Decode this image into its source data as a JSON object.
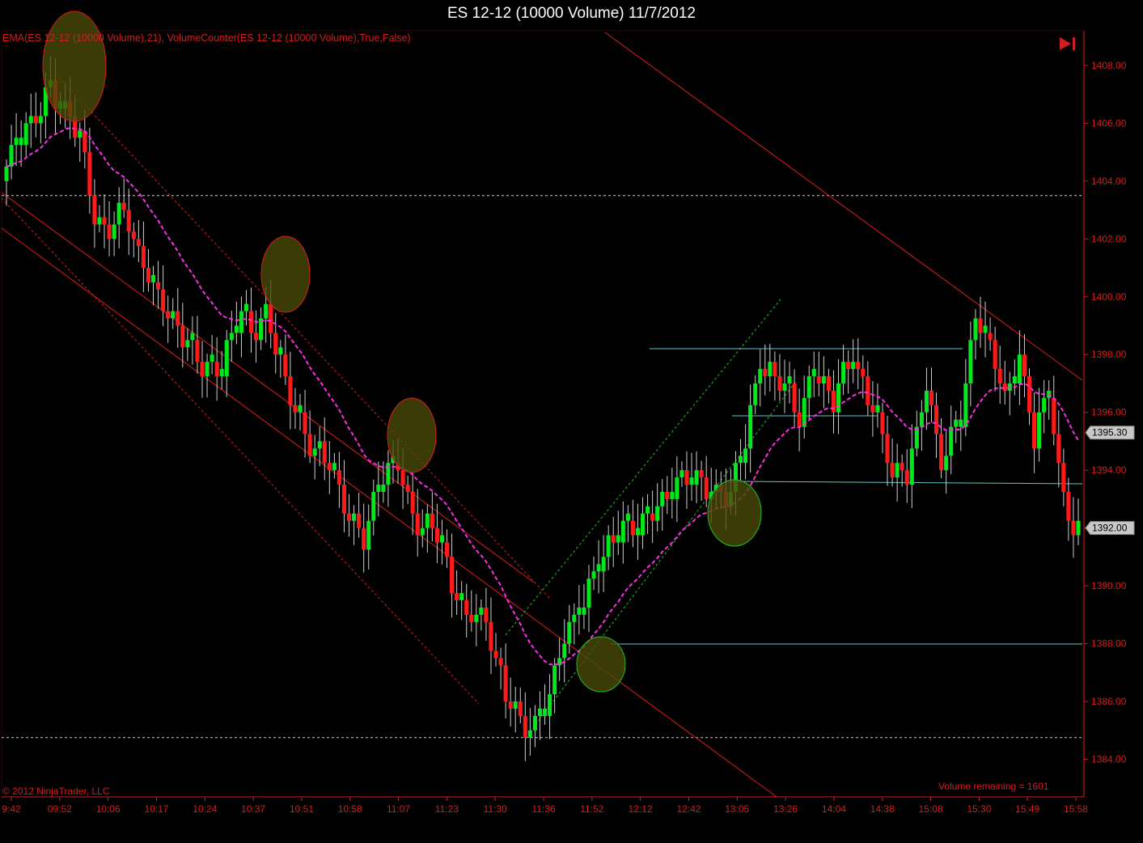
{
  "window": {
    "title": "ES 12-12 (10000 Volume)  11/7/2012"
  },
  "indicator_label": "EMA(ES  12-12  (10000  Volume),21),  VolumeCounter(ES  12-12  (10000  Volume),True,False)",
  "copyright": "© 2012 NinjaTrader, LLC",
  "volume_remaining": "Volume remaining = 1601",
  "icons": {
    "skip_to_end": "skip-to-end-icon"
  },
  "colors": {
    "up": "#00e81c",
    "down": "#ff1a1a",
    "ema": "#ff2ee6",
    "axis": "#d21e1e",
    "trend": "#e01c1c",
    "channel": "#1ec21e",
    "level": "#5fc8c8",
    "ellipse_fill": "#4a4a0a"
  },
  "chart_data": {
    "type": "candlestick",
    "title": "ES 12-12 (10000 Volume)  11/7/2012",
    "ylim": [
      1382.7,
      1409.2
    ],
    "y_ticks": [
      "1408.00",
      "1406.00",
      "1404.00",
      "1402.00",
      "1400.00",
      "1398.00",
      "1396.00",
      "1394.00",
      "1392.00",
      "1390.00",
      "1388.00",
      "1386.00",
      "1384.00"
    ],
    "x_ticks": [
      "9:42",
      "09:52",
      "10:06",
      "10:17",
      "10:24",
      "10:37",
      "10:51",
      "10:58",
      "11:07",
      "11:23",
      "11:30",
      "11:36",
      "11:52",
      "12:12",
      "12:42",
      "13:05",
      "13:26",
      "14:04",
      "14:38",
      "15:08",
      "15:30",
      "15:49",
      "15:58"
    ],
    "price_tags": [
      "1395.30",
      "1392.00"
    ],
    "horizontal_levels": [
      1403.5,
      1384.75
    ],
    "pivots": [
      {
        "bar": 0,
        "price": 1404.5
      },
      {
        "bar": 5,
        "price": 1406.0
      },
      {
        "bar": 9,
        "price": 1407.4
      },
      {
        "bar": 12,
        "price": 1406.2
      },
      {
        "bar": 15,
        "price": 1405.5
      },
      {
        "bar": 18,
        "price": 1403.0
      },
      {
        "bar": 21,
        "price": 1402.2
      },
      {
        "bar": 24,
        "price": 1402.8
      },
      {
        "bar": 27,
        "price": 1401.6
      },
      {
        "bar": 30,
        "price": 1400.5
      },
      {
        "bar": 33,
        "price": 1399.2
      },
      {
        "bar": 37,
        "price": 1398.4
      },
      {
        "bar": 41,
        "price": 1397.6
      },
      {
        "bar": 44,
        "price": 1397.3
      },
      {
        "bar": 48,
        "price": 1399.6
      },
      {
        "bar": 50,
        "price": 1398.9
      },
      {
        "bar": 53,
        "price": 1399.3
      },
      {
        "bar": 57,
        "price": 1396.9
      },
      {
        "bar": 62,
        "price": 1395.0
      },
      {
        "bar": 66,
        "price": 1394.0
      },
      {
        "bar": 70,
        "price": 1392.6
      },
      {
        "bar": 73,
        "price": 1391.7
      },
      {
        "bar": 77,
        "price": 1393.7
      },
      {
        "bar": 80,
        "price": 1394.4
      },
      {
        "bar": 84,
        "price": 1392.0
      },
      {
        "bar": 88,
        "price": 1391.8
      },
      {
        "bar": 91,
        "price": 1390.3
      },
      {
        "bar": 94,
        "price": 1389.0
      },
      {
        "bar": 98,
        "price": 1388.6
      },
      {
        "bar": 102,
        "price": 1386.5
      },
      {
        "bar": 106,
        "price": 1385.0
      },
      {
        "bar": 108,
        "price": 1384.9
      },
      {
        "bar": 111,
        "price": 1386.4
      },
      {
        "bar": 114,
        "price": 1388.4
      },
      {
        "bar": 118,
        "price": 1389.2
      },
      {
        "bar": 121,
        "price": 1391.0
      },
      {
        "bar": 125,
        "price": 1392.0
      },
      {
        "bar": 129,
        "price": 1391.7
      },
      {
        "bar": 133,
        "price": 1393.0
      },
      {
        "bar": 137,
        "price": 1393.4
      },
      {
        "bar": 141,
        "price": 1393.7
      },
      {
        "bar": 145,
        "price": 1393.4
      },
      {
        "bar": 148,
        "price": 1393.0
      },
      {
        "bar": 151,
        "price": 1395.0
      },
      {
        "bar": 154,
        "price": 1397.9
      },
      {
        "bar": 158,
        "price": 1397.0
      },
      {
        "bar": 162,
        "price": 1395.8
      },
      {
        "bar": 165,
        "price": 1397.8
      },
      {
        "bar": 169,
        "price": 1396.3
      },
      {
        "bar": 173,
        "price": 1398.0
      },
      {
        "bar": 177,
        "price": 1396.3
      },
      {
        "bar": 181,
        "price": 1393.7
      },
      {
        "bar": 184,
        "price": 1394.0
      },
      {
        "bar": 188,
        "price": 1397.0
      },
      {
        "bar": 191,
        "price": 1394.0
      },
      {
        "bar": 195,
        "price": 1396.0
      },
      {
        "bar": 198,
        "price": 1399.4
      },
      {
        "bar": 201,
        "price": 1398.0
      },
      {
        "bar": 204,
        "price": 1396.5
      },
      {
        "bar": 207,
        "price": 1398.2
      },
      {
        "bar": 210,
        "price": 1395.0
      },
      {
        "bar": 213,
        "price": 1396.7
      },
      {
        "bar": 215,
        "price": 1394.0
      },
      {
        "bar": 218,
        "price": 1392.0
      }
    ]
  }
}
